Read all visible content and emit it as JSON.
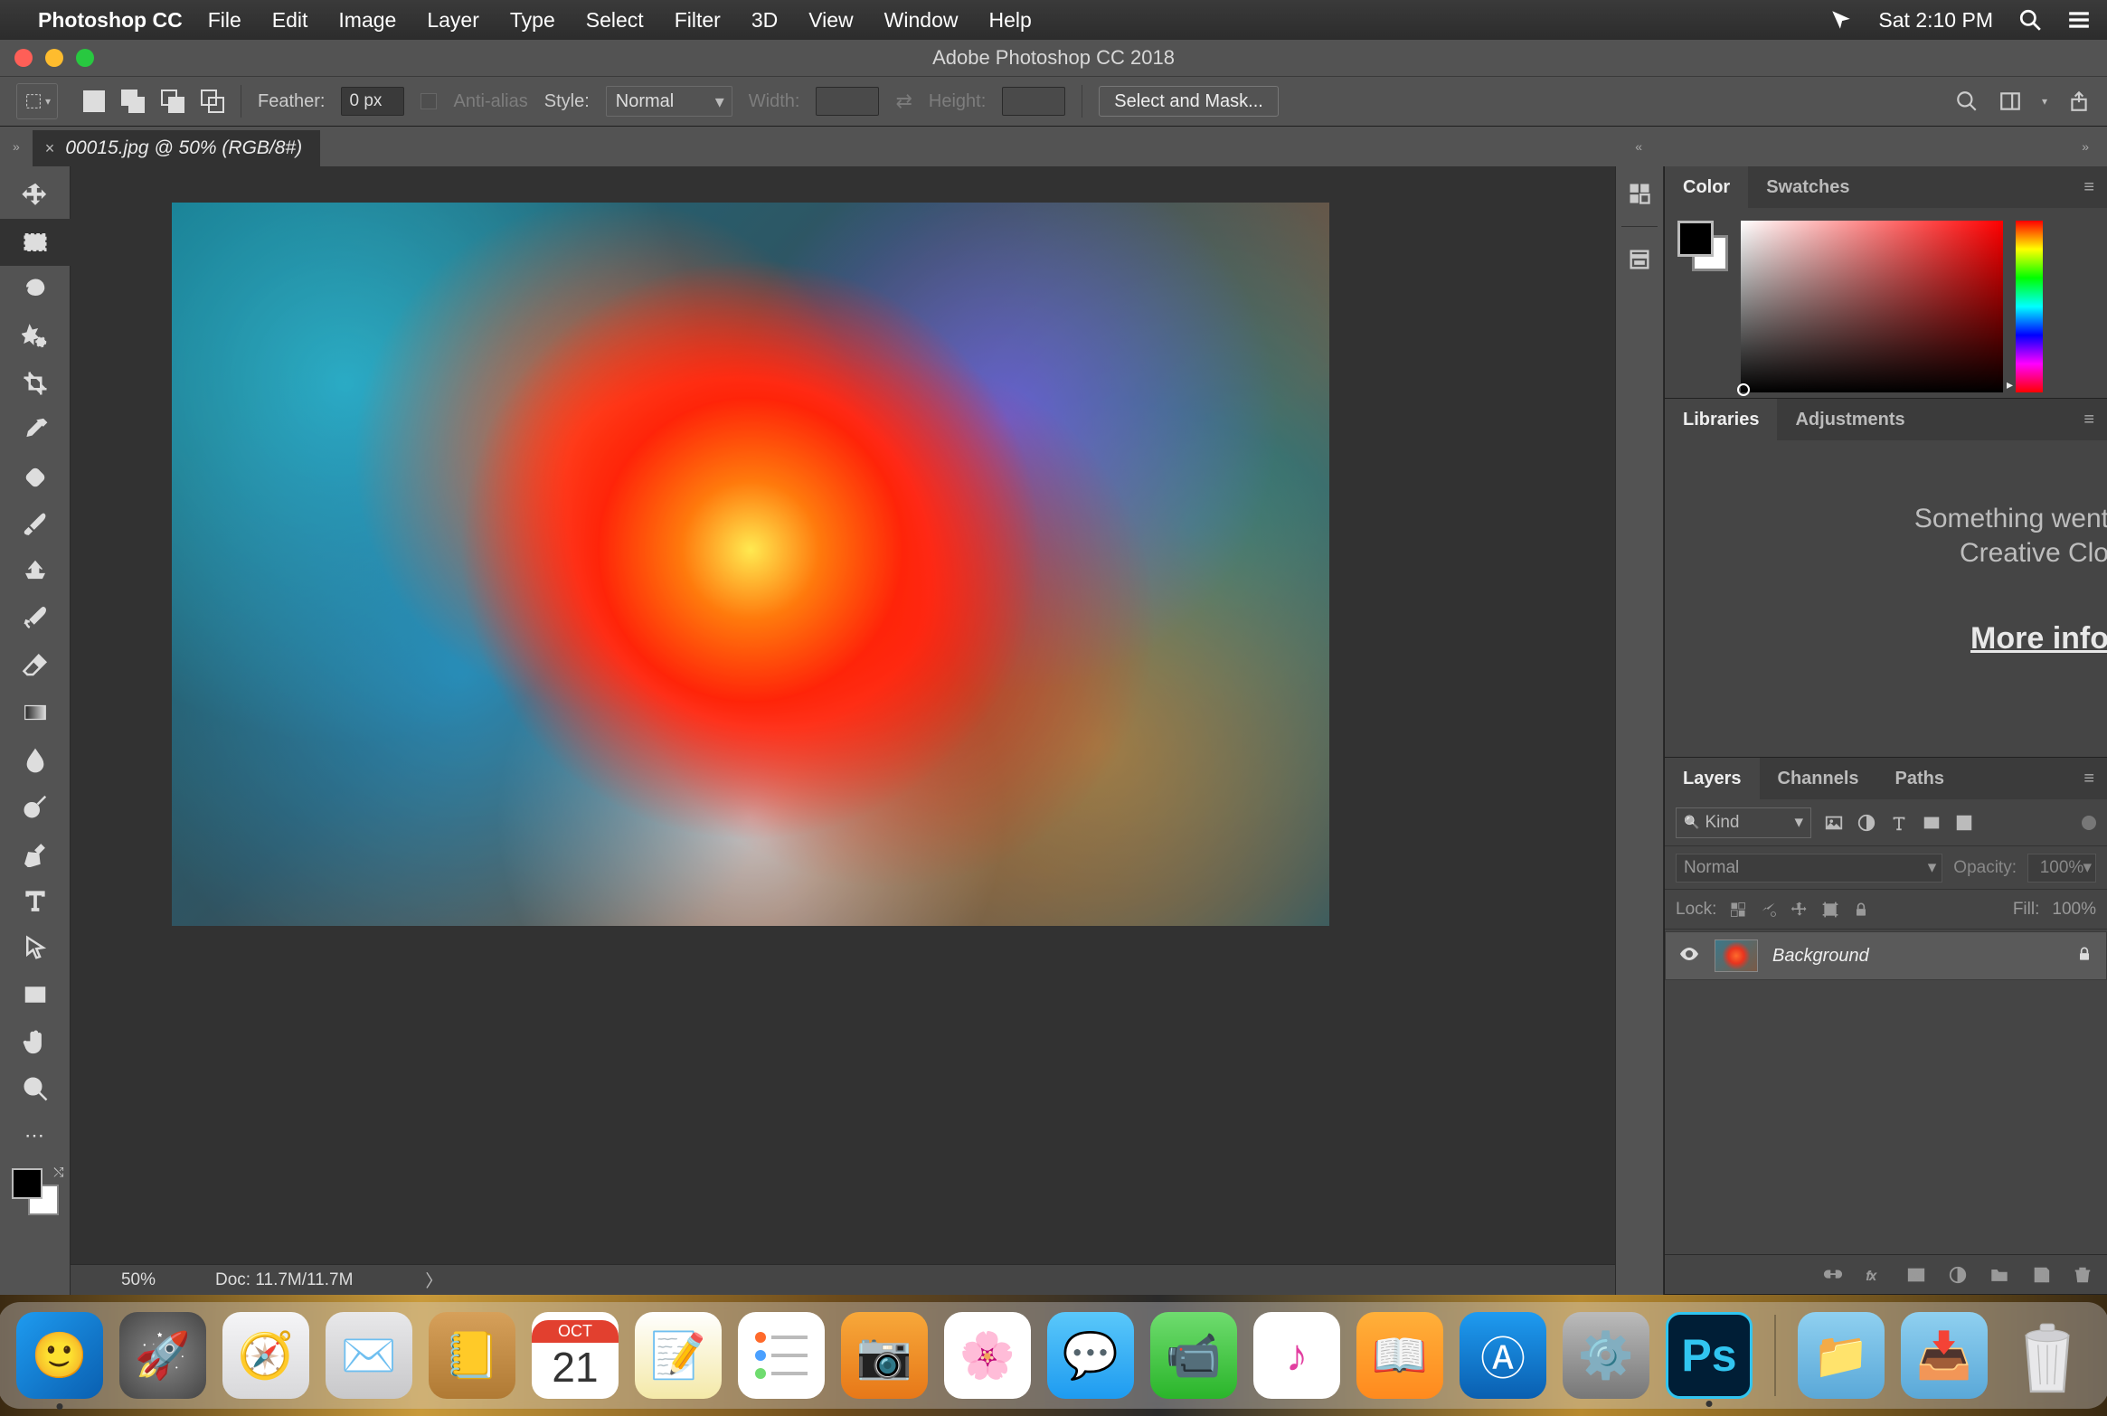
{
  "menubar": {
    "app": "Photoshop CC",
    "items": [
      "File",
      "Edit",
      "Image",
      "Layer",
      "Type",
      "Select",
      "Filter",
      "3D",
      "View",
      "Window",
      "Help"
    ],
    "clock": "Sat 2:10 PM"
  },
  "window": {
    "title": "Adobe Photoshop CC 2018"
  },
  "optionsbar": {
    "feather_label": "Feather:",
    "feather_value": "0 px",
    "antialias_label": "Anti-alias",
    "style_label": "Style:",
    "style_value": "Normal",
    "width_label": "Width:",
    "width_value": "",
    "height_label": "Height:",
    "height_value": "",
    "select_mask_btn": "Select and Mask..."
  },
  "document": {
    "tab_label": "00015.jpg @ 50% (RGB/8#)",
    "zoom": "50%",
    "docsize": "Doc: 11.7M/11.7M"
  },
  "tools": [
    "move-tool",
    "rectangular-marquee-tool",
    "lasso-tool",
    "quick-selection-tool",
    "crop-tool",
    "eyedropper-tool",
    "spot-healing-tool",
    "brush-tool",
    "clone-stamp-tool",
    "history-brush-tool",
    "eraser-tool",
    "gradient-tool",
    "blur-tool",
    "dodge-tool",
    "pen-tool",
    "type-tool",
    "path-selection-tool",
    "rectangle-tool",
    "hand-tool",
    "zoom-tool"
  ],
  "panels": {
    "color": {
      "tabs": [
        "Color",
        "Swatches"
      ],
      "active": 0
    },
    "libraries": {
      "tabs": [
        "Libraries",
        "Adjustments"
      ],
      "active": 0,
      "msg_line1": "Something went",
      "msg_line2": "Creative Clo",
      "more": "More info"
    },
    "layers": {
      "tabs": [
        "Layers",
        "Channels",
        "Paths"
      ],
      "active": 0,
      "filter_kind": "Kind",
      "blend_mode": "Normal",
      "opacity_label": "Opacity:",
      "opacity_value": "100%",
      "lock_label": "Lock:",
      "fill_label": "Fill:",
      "fill_value": "100%",
      "layer_name": "Background"
    }
  },
  "dock": {
    "cal_month": "OCT",
    "cal_day": "21",
    "ps_label": "Ps"
  }
}
